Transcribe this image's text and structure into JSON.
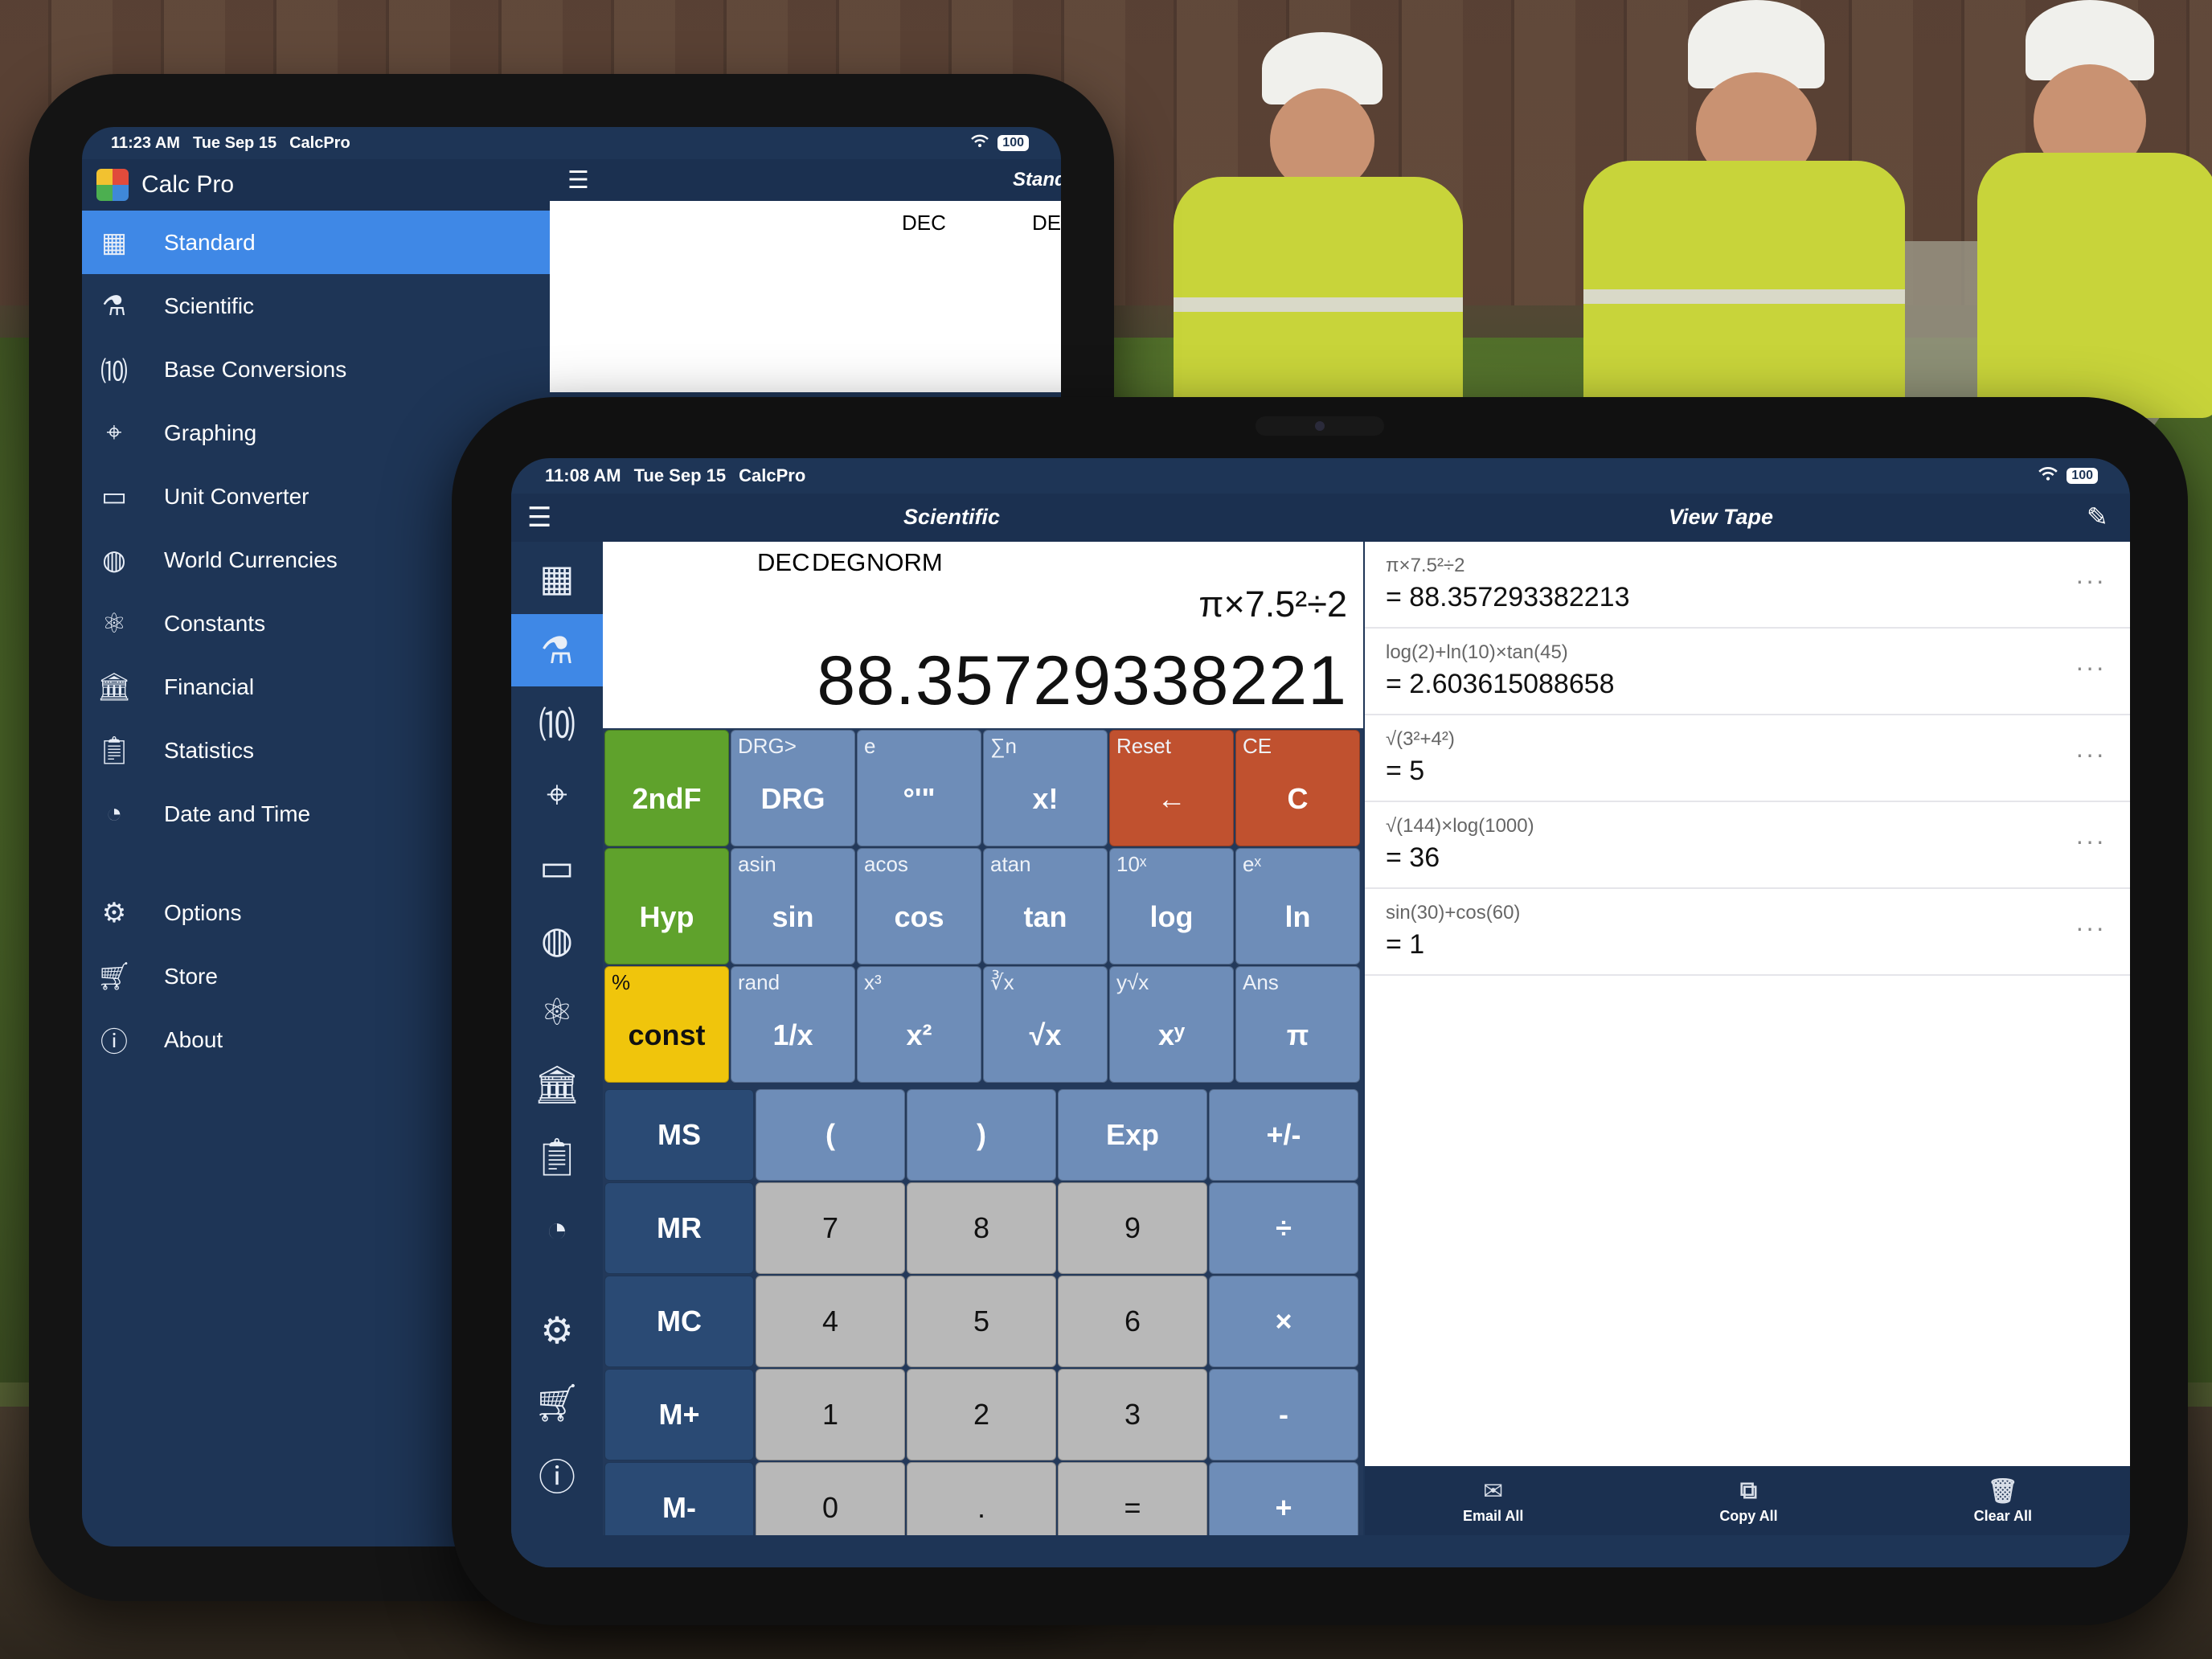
{
  "back_ipad": {
    "status": {
      "time": "11:23 AM",
      "date": "Tue Sep 15",
      "app": "CalcPro",
      "battery": "100"
    },
    "sidebar_title": "Calc Pro",
    "menu_items": [
      {
        "label": "Standard",
        "icon": "calculator-icon",
        "active": true
      },
      {
        "label": "Scientific",
        "icon": "microscope-icon",
        "active": false
      },
      {
        "label": "Base Conversions",
        "icon": "base-conversion-icon",
        "active": false
      },
      {
        "label": "Graphing",
        "icon": "graph-axes-icon",
        "active": false
      },
      {
        "label": "Unit Converter",
        "icon": "ruler-icon",
        "active": false
      },
      {
        "label": "World Currencies",
        "icon": "globe-icon",
        "active": false
      },
      {
        "label": "Constants",
        "icon": "atom-icon",
        "active": false
      },
      {
        "label": "Financial",
        "icon": "bank-icon",
        "active": false
      },
      {
        "label": "Statistics",
        "icon": "clipboard-chart-icon",
        "active": false
      },
      {
        "label": "Date and Time",
        "icon": "clock-calendar-icon",
        "active": false
      }
    ],
    "secondary_items": [
      {
        "label": "Options",
        "icon": "gear-icon"
      },
      {
        "label": "Store",
        "icon": "cart-icon"
      },
      {
        "label": "About",
        "icon": "info-icon"
      }
    ],
    "toolbar_title": "Standa",
    "display_modes": [
      "DEC",
      "DE"
    ]
  },
  "front_ipad": {
    "status": {
      "time": "11:08 AM",
      "date": "Tue Sep 15",
      "app": "CalcPro",
      "battery": "100"
    },
    "calc_title": "Scientific",
    "tape_title": "View Tape",
    "display": {
      "modes": [
        "DEC",
        "DEG",
        "NORM"
      ],
      "expression": "π×7.5²÷2",
      "result": "88.35729338221"
    },
    "rail_icons": [
      "calculator-icon",
      "microscope-icon",
      "base-conversion-icon",
      "graph-axes-icon",
      "ruler-icon",
      "globe-icon",
      "atom-icon",
      "bank-icon",
      "clipboard-chart-icon",
      "clock-calendar-icon",
      "gear-icon",
      "cart-icon",
      "info-icon"
    ],
    "keys_top": [
      [
        {
          "sec": "",
          "pri": "2ndF",
          "style": "green"
        },
        {
          "sec": "DRG>",
          "pri": "DRG",
          "style": "blue"
        },
        {
          "sec": "e",
          "pri": "°'\"",
          "style": "blue"
        },
        {
          "sec": "∑n",
          "pri": "x!",
          "style": "blue"
        },
        {
          "sec": "Reset",
          "pri": "←",
          "style": "red"
        },
        {
          "sec": "CE",
          "pri": "C",
          "style": "red"
        }
      ],
      [
        {
          "sec": "",
          "pri": "Hyp",
          "style": "green"
        },
        {
          "sec": "asin",
          "pri": "sin",
          "style": "blue"
        },
        {
          "sec": "acos",
          "pri": "cos",
          "style": "blue"
        },
        {
          "sec": "atan",
          "pri": "tan",
          "style": "blue"
        },
        {
          "sec": "10ˣ",
          "pri": "log",
          "style": "blue"
        },
        {
          "sec": "eˣ",
          "pri": "ln",
          "style": "blue"
        }
      ],
      [
        {
          "sec": "%",
          "pri": "const",
          "style": "yellow"
        },
        {
          "sec": "rand",
          "pri": "1/x",
          "style": "blue"
        },
        {
          "sec": "x³",
          "pri": "x²",
          "style": "blue"
        },
        {
          "sec": "∛x",
          "pri": "√x",
          "style": "blue"
        },
        {
          "sec": "y√x",
          "pri": "xʸ",
          "style": "blue"
        },
        {
          "sec": "Ans",
          "pri": "π",
          "style": "blue"
        }
      ]
    ],
    "keys_bottom": [
      [
        {
          "pri": "MS",
          "style": "dark"
        },
        {
          "pri": "(",
          "style": "op"
        },
        {
          "pri": ")",
          "style": "op"
        },
        {
          "pri": "Exp",
          "style": "op"
        },
        {
          "pri": "+/-",
          "style": "op"
        }
      ],
      [
        {
          "pri": "MR",
          "style": "dark"
        },
        {
          "pri": "7",
          "style": "gray"
        },
        {
          "pri": "8",
          "style": "gray"
        },
        {
          "pri": "9",
          "style": "gray"
        },
        {
          "pri": "÷",
          "style": "op"
        }
      ],
      [
        {
          "pri": "MC",
          "style": "dark"
        },
        {
          "pri": "4",
          "style": "gray"
        },
        {
          "pri": "5",
          "style": "gray"
        },
        {
          "pri": "6",
          "style": "gray"
        },
        {
          "pri": "×",
          "style": "op"
        }
      ],
      [
        {
          "pri": "M+",
          "style": "dark"
        },
        {
          "pri": "1",
          "style": "gray"
        },
        {
          "pri": "2",
          "style": "gray"
        },
        {
          "pri": "3",
          "style": "gray"
        },
        {
          "pri": "-",
          "style": "op"
        }
      ],
      [
        {
          "pri": "M-",
          "style": "dark"
        },
        {
          "pri": "0",
          "style": "gray"
        },
        {
          "pri": ".",
          "style": "gray"
        },
        {
          "pri": "=",
          "style": "gray"
        },
        {
          "pri": "+",
          "style": "op"
        }
      ]
    ],
    "tape": [
      {
        "expr": "π×7.5²÷2",
        "result": "= 88.357293382213"
      },
      {
        "expr": "log(2)+ln(10)×tan(45)",
        "result": "= 2.603615088658"
      },
      {
        "expr": "√(3²+4²)",
        "result": "= 5"
      },
      {
        "expr": "√(144)×log(1000)",
        "result": "= 36"
      },
      {
        "expr": "sin(30)+cos(60)",
        "result": "= 1"
      }
    ],
    "tape_more": "···",
    "tape_actions": [
      {
        "label": "Email All",
        "icon": "envelope-icon"
      },
      {
        "label": "Copy All",
        "icon": "copy-icon"
      },
      {
        "label": "Clear All",
        "icon": "trash-icon"
      }
    ]
  },
  "colors": {
    "navy": "#1e3556",
    "accent": "#3f88e6",
    "green": "#5fa22c",
    "yellow": "#f0c50c",
    "red": "#c0512f",
    "key_blue": "#6e8db8",
    "key_dark": "#2a4a74",
    "key_gray": "#b8b8b8"
  }
}
